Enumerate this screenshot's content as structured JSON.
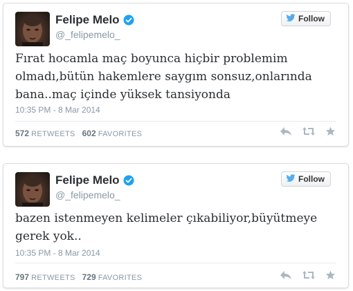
{
  "colors": {
    "twitter_blue": "#55acee",
    "text": "#292f33",
    "muted": "#8899a6",
    "verified": "#1da1f2"
  },
  "tweets": [
    {
      "display_name": "Felipe Melo",
      "handle": "@_felipemelo_",
      "follow_label": "Follow",
      "text": "Fırat hocamla maç boyunca hiçbir problemim olmadı,bütün hakemlere saygım sonsuz,onlarında bana..maç içinde yüksek tansiyonda",
      "timestamp": "10:35 PM - 8 Mar 2014",
      "retweets": "572",
      "retweets_label": "RETWEETS",
      "favorites": "602",
      "favorites_label": "FAVORITES",
      "icons": [
        "verified-icon",
        "twitter-bird-icon",
        "reply-icon",
        "retweet-icon",
        "favorite-star-icon"
      ]
    },
    {
      "display_name": "Felipe Melo",
      "handle": "@_felipemelo_",
      "follow_label": "Follow",
      "text": "bazen istenmeyen kelimeler çıkabiliyor,büyütmeye gerek yok..",
      "timestamp": "10:35 PM - 8 Mar 2014",
      "retweets": "797",
      "retweets_label": "RETWEETS",
      "favorites": "729",
      "favorites_label": "FAVORITES",
      "icons": [
        "verified-icon",
        "twitter-bird-icon",
        "reply-icon",
        "retweet-icon",
        "favorite-star-icon"
      ]
    }
  ]
}
